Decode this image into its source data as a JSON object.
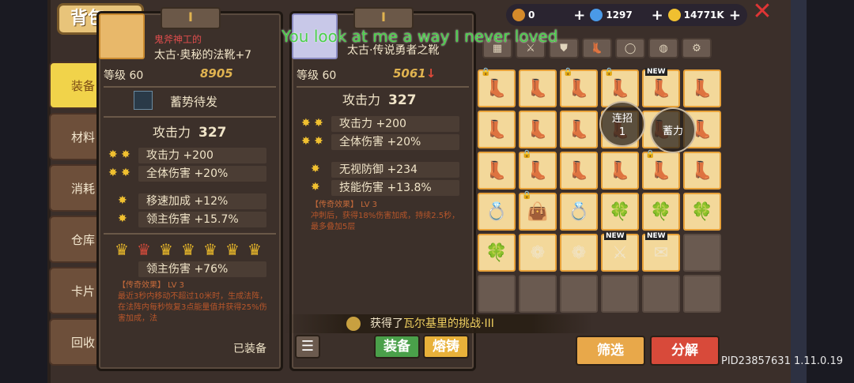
{
  "header": {
    "title": "背包",
    "currencies": [
      {
        "icon": "wing-icon",
        "value": "0",
        "color": "#d48a2a"
      },
      {
        "icon": "gem-icon",
        "value": "1297",
        "color": "#4a9ae8"
      },
      {
        "icon": "coin-icon",
        "value": "14771K",
        "color": "#f0c030"
      }
    ],
    "plus": "+",
    "close": "✕"
  },
  "side_tabs": [
    "装备",
    "材料",
    "消耗",
    "仓库",
    "卡片",
    "回收"
  ],
  "card_a": {
    "badge": "Ⅰ",
    "name_sub": "鬼斧神工的",
    "name": "太古·奥秘的法靴+7",
    "level": "等级 60",
    "score": "8905",
    "skill": "蓄势待发",
    "attack": {
      "label": "攻击力",
      "value": "327"
    },
    "stats": [
      "攻击力 +200",
      "全体伤害 +20%",
      "移速加成 +12%",
      "领主伤害 +15.7%"
    ],
    "crown_stat": "领主伤害 +76%",
    "legend_header": "【传奇效果】 LV 3",
    "legend_text": "最近3秒内移动不超过10米时，生成法阵，在法阵内每秒恢复3点能量值并获得25%伤害加成，法",
    "equipped": "已装备"
  },
  "card_b": {
    "badge": "Ⅰ",
    "name": "太古·传说勇者之靴",
    "level": "等级 60",
    "score": "5061",
    "score_arrow": "↓",
    "attack": {
      "label": "攻击力",
      "value": "327"
    },
    "stats": [
      "攻击力 +200",
      "全体伤害 +20%",
      "无视防御 +234",
      "技能伤害 +13.8%"
    ],
    "legend_header": "【传奇效果】 LV 3",
    "legend_text": "冲刺后，获得18%伤害加成，持续2.5秒，最多叠加5层",
    "list_button": "☰",
    "equip_button": "装备",
    "forge_button": "熔铸"
  },
  "grid": {
    "badges": [
      "NEW",
      "NEW",
      "NEW"
    ],
    "combo_bubble": {
      "title": "连招",
      "count": "1"
    },
    "charge_bubble": "蓄力"
  },
  "buttons": {
    "filter": "筛选",
    "decompose": "分解"
  },
  "notification": {
    "prefix": "获得了",
    "highlight": "瓦尔基里的挑战·III"
  },
  "overlay_lyric": "You look at me a way I never loved",
  "version": "PID23857631 1.11.0.19"
}
